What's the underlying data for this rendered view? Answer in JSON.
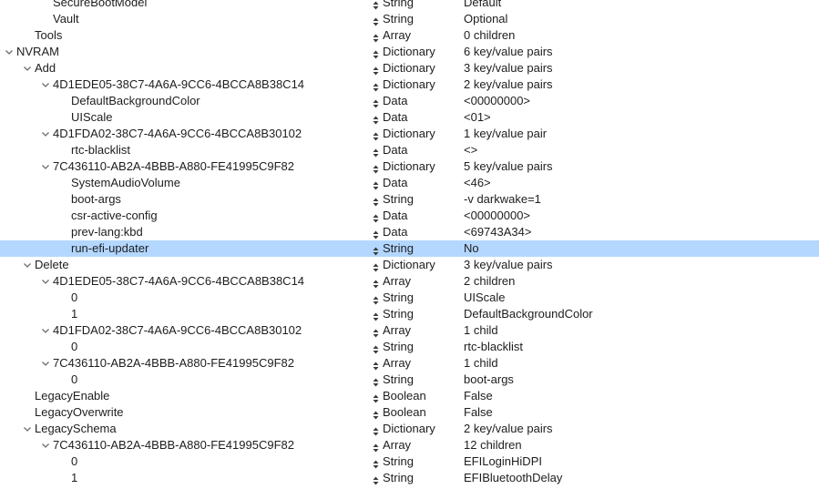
{
  "rows": [
    {
      "key": "SecureBootModel",
      "type": "String",
      "value": "Default",
      "depth": 3,
      "expandable": false,
      "expanded": false,
      "selected": false
    },
    {
      "key": "Vault",
      "type": "String",
      "value": "Optional",
      "depth": 3,
      "expandable": false,
      "expanded": false,
      "selected": false
    },
    {
      "key": "Tools",
      "type": "Array",
      "value": "0 children",
      "depth": 2,
      "expandable": false,
      "expanded": false,
      "selected": false
    },
    {
      "key": "NVRAM",
      "type": "Dictionary",
      "value": "6 key/value pairs",
      "depth": 1,
      "expandable": true,
      "expanded": true,
      "selected": false
    },
    {
      "key": "Add",
      "type": "Dictionary",
      "value": "3 key/value pairs",
      "depth": 2,
      "expandable": true,
      "expanded": true,
      "selected": false
    },
    {
      "key": "4D1EDE05-38C7-4A6A-9CC6-4BCCA8B38C14",
      "type": "Dictionary",
      "value": "2 key/value pairs",
      "depth": 3,
      "expandable": true,
      "expanded": true,
      "selected": false
    },
    {
      "key": "DefaultBackgroundColor",
      "type": "Data",
      "value": "<00000000>",
      "depth": 4,
      "expandable": false,
      "expanded": false,
      "selected": false
    },
    {
      "key": "UIScale",
      "type": "Data",
      "value": "<01>",
      "depth": 4,
      "expandable": false,
      "expanded": false,
      "selected": false
    },
    {
      "key": "4D1FDA02-38C7-4A6A-9CC6-4BCCA8B30102",
      "type": "Dictionary",
      "value": "1 key/value pair",
      "depth": 3,
      "expandable": true,
      "expanded": true,
      "selected": false
    },
    {
      "key": "rtc-blacklist",
      "type": "Data",
      "value": "<>",
      "depth": 4,
      "expandable": false,
      "expanded": false,
      "selected": false
    },
    {
      "key": "7C436110-AB2A-4BBB-A880-FE41995C9F82",
      "type": "Dictionary",
      "value": "5 key/value pairs",
      "depth": 3,
      "expandable": true,
      "expanded": true,
      "selected": false
    },
    {
      "key": "SystemAudioVolume",
      "type": "Data",
      "value": "<46>",
      "depth": 4,
      "expandable": false,
      "expanded": false,
      "selected": false
    },
    {
      "key": "boot-args",
      "type": "String",
      "value": "-v darkwake=1",
      "depth": 4,
      "expandable": false,
      "expanded": false,
      "selected": false
    },
    {
      "key": "csr-active-config",
      "type": "Data",
      "value": "<00000000>",
      "depth": 4,
      "expandable": false,
      "expanded": false,
      "selected": false
    },
    {
      "key": "prev-lang:kbd",
      "type": "Data",
      "value": "<69743A34>",
      "depth": 4,
      "expandable": false,
      "expanded": false,
      "selected": false
    },
    {
      "key": "run-efi-updater",
      "type": "String",
      "value": "No",
      "depth": 4,
      "expandable": false,
      "expanded": false,
      "selected": true
    },
    {
      "key": "Delete",
      "type": "Dictionary",
      "value": "3 key/value pairs",
      "depth": 2,
      "expandable": true,
      "expanded": true,
      "selected": false
    },
    {
      "key": "4D1EDE05-38C7-4A6A-9CC6-4BCCA8B38C14",
      "type": "Array",
      "value": "2 children",
      "depth": 3,
      "expandable": true,
      "expanded": true,
      "selected": false
    },
    {
      "key": "0",
      "type": "String",
      "value": "UIScale",
      "depth": 4,
      "expandable": false,
      "expanded": false,
      "selected": false
    },
    {
      "key": "1",
      "type": "String",
      "value": "DefaultBackgroundColor",
      "depth": 4,
      "expandable": false,
      "expanded": false,
      "selected": false
    },
    {
      "key": "4D1FDA02-38C7-4A6A-9CC6-4BCCA8B30102",
      "type": "Array",
      "value": "1 child",
      "depth": 3,
      "expandable": true,
      "expanded": true,
      "selected": false
    },
    {
      "key": "0",
      "type": "String",
      "value": "rtc-blacklist",
      "depth": 4,
      "expandable": false,
      "expanded": false,
      "selected": false
    },
    {
      "key": "7C436110-AB2A-4BBB-A880-FE41995C9F82",
      "type": "Array",
      "value": "1 child",
      "depth": 3,
      "expandable": true,
      "expanded": true,
      "selected": false
    },
    {
      "key": "0",
      "type": "String",
      "value": "boot-args",
      "depth": 4,
      "expandable": false,
      "expanded": false,
      "selected": false
    },
    {
      "key": "LegacyEnable",
      "type": "Boolean",
      "value": "False",
      "depth": 2,
      "expandable": false,
      "expanded": false,
      "selected": false
    },
    {
      "key": "LegacyOverwrite",
      "type": "Boolean",
      "value": "False",
      "depth": 2,
      "expandable": false,
      "expanded": false,
      "selected": false
    },
    {
      "key": "LegacySchema",
      "type": "Dictionary",
      "value": "2 key/value pairs",
      "depth": 2,
      "expandable": true,
      "expanded": true,
      "selected": false
    },
    {
      "key": "7C436110-AB2A-4BBB-A880-FE41995C9F82",
      "type": "Array",
      "value": "12 children",
      "depth": 3,
      "expandable": true,
      "expanded": true,
      "selected": false
    },
    {
      "key": "0",
      "type": "String",
      "value": "EFILoginHiDPI",
      "depth": 4,
      "expandable": false,
      "expanded": false,
      "selected": false
    },
    {
      "key": "1",
      "type": "String",
      "value": "EFIBluetoothDelay",
      "depth": 4,
      "expandable": false,
      "expanded": false,
      "selected": false
    }
  ],
  "colors": {
    "selection": "#b3d7ff",
    "text": "#1d1d1f",
    "disclosure": "#6e6e73"
  }
}
